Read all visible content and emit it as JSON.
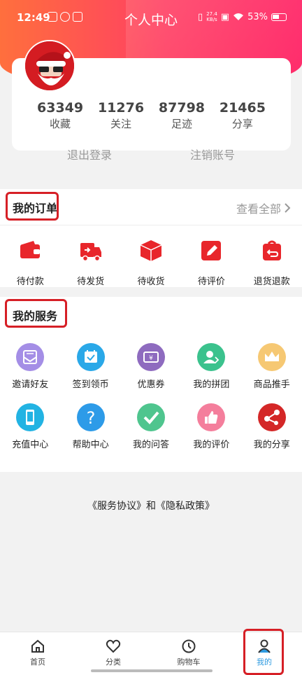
{
  "status_bar": {
    "time": "12:49",
    "battery": "53%",
    "net_speed_value": "27.4",
    "net_speed_unit": "KB/s"
  },
  "page": {
    "title": "个人中心"
  },
  "profile": {
    "stats": [
      {
        "value": "63349",
        "label": "收藏"
      },
      {
        "value": "11276",
        "label": "关注"
      },
      {
        "value": "87798",
        "label": "足迹"
      },
      {
        "value": "21465",
        "label": "分享"
      }
    ],
    "logout": "退出登录",
    "cancel_account": "注销账号"
  },
  "orders": {
    "title": "我的订单",
    "view_all": "查看全部",
    "items": [
      {
        "label": "待付款",
        "icon": "wallet-icon"
      },
      {
        "label": "待发货",
        "icon": "truck-icon"
      },
      {
        "label": "待收货",
        "icon": "box-icon"
      },
      {
        "label": "待评价",
        "icon": "pen-icon"
      },
      {
        "label": "退货退款",
        "icon": "return-icon"
      }
    ]
  },
  "services": {
    "title": "我的服务",
    "items": [
      {
        "label": "邀请好友",
        "icon": "mail-icon",
        "color": "#a48ee6"
      },
      {
        "label": "签到领币",
        "icon": "calendar-icon",
        "color": "#2aa8e8"
      },
      {
        "label": "优惠券",
        "icon": "coupon-icon",
        "color": "#8e6bbf"
      },
      {
        "label": "我的拼团",
        "icon": "group-icon",
        "color": "#3bc28d"
      },
      {
        "label": "商品推手",
        "icon": "crown-icon",
        "color": "#f6c873"
      },
      {
        "label": "充值中心",
        "icon": "phone-icon",
        "color": "#22b3e3"
      },
      {
        "label": "帮助中心",
        "icon": "question-icon",
        "color": "#2d9be8"
      },
      {
        "label": "我的问答",
        "icon": "check-icon",
        "color": "#4fc58e"
      },
      {
        "label": "我的评价",
        "icon": "thumb-icon",
        "color": "#f47e9c"
      },
      {
        "label": "我的分享",
        "icon": "share-icon",
        "color": "#d42727"
      }
    ]
  },
  "policy": "《服务协议》和《隐私政策》",
  "tabs": [
    {
      "label": "首页",
      "icon": "home-icon"
    },
    {
      "label": "分类",
      "icon": "heart-icon"
    },
    {
      "label": "购物车",
      "icon": "clock-icon"
    },
    {
      "label": "我的",
      "icon": "user-icon",
      "active_color": "#2f9be0"
    }
  ],
  "colors": {
    "accent": "#ff3f63",
    "order_red": "#e8262b",
    "highlight": "#d61f26"
  }
}
